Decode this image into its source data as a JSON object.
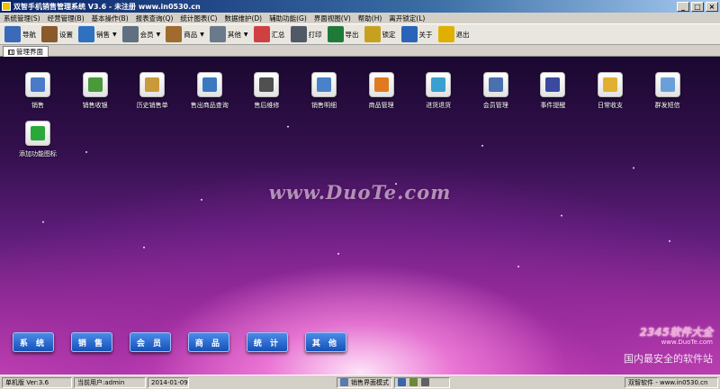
{
  "window": {
    "title": "双智手机销售管理系统 V3.6  - 未注册 www.in0530.cn"
  },
  "menu": [
    "系统管理(S)",
    "经营管理(B)",
    "基本操作(B)",
    "报表查询(Q)",
    "统计图表(C)",
    "数据维护(D)",
    "辅助功能(G)",
    "界面视图(V)",
    "帮助(H)",
    "离开锁定(L)"
  ],
  "toolbar": [
    {
      "label": "导航",
      "icon": "monitor-icon",
      "color": "#3a6ab8",
      "dropdown": false
    },
    {
      "label": "设置",
      "icon": "settings-book-icon",
      "color": "#8a5a2a",
      "dropdown": false
    },
    {
      "label": "销售",
      "icon": "shop-icon",
      "color": "#3070c0",
      "dropdown": true
    },
    {
      "label": "会员",
      "icon": "member-card-icon",
      "color": "#607080",
      "dropdown": true
    },
    {
      "label": "商品",
      "icon": "goods-box-icon",
      "color": "#a06a30",
      "dropdown": true
    },
    {
      "label": "其他",
      "icon": "grid-table-icon",
      "color": "#6a7a8a",
      "dropdown": true
    },
    {
      "label": "汇总",
      "icon": "pie-chart-icon",
      "color": "#d04040",
      "dropdown": false
    },
    {
      "label": "打印",
      "icon": "printer-icon",
      "color": "#505a66",
      "dropdown": false
    },
    {
      "label": "导出",
      "icon": "excel-icon",
      "color": "#1f7a3a",
      "dropdown": false
    },
    {
      "label": "锁定",
      "icon": "lock-icon",
      "color": "#c8a020",
      "dropdown": false
    },
    {
      "label": "关于",
      "icon": "about-monitor-icon",
      "color": "#2a64b8",
      "dropdown": false
    },
    {
      "label": "退出",
      "icon": "exit-runner-icon",
      "color": "#e0b000",
      "dropdown": false
    }
  ],
  "tab": {
    "label": "管理界面"
  },
  "desktop_icons": [
    {
      "label": "销售",
      "icon": "sales-icon",
      "color": "#4a7ac8"
    },
    {
      "label": "销售收银",
      "icon": "cashier-yen-icon",
      "color": "#4a9a3a"
    },
    {
      "label": "历史销售单",
      "icon": "history-order-icon",
      "color": "#c89a3a"
    },
    {
      "label": "售出商品查询",
      "icon": "sold-query-icon",
      "color": "#3a78c0"
    },
    {
      "label": "售后维修",
      "icon": "repair-tools-icon",
      "color": "#505050"
    },
    {
      "label": "销售明细",
      "icon": "sales-detail-icon",
      "color": "#4a82c8"
    },
    {
      "label": "商品管理",
      "icon": "goods-manage-icon",
      "color": "#e07a20"
    },
    {
      "label": "进货退货",
      "icon": "purchase-return-icon",
      "color": "#3aa0d0"
    },
    {
      "label": "会员管理",
      "icon": "member-manage-icon",
      "color": "#4a70b0"
    },
    {
      "label": "事件提醒",
      "icon": "clock-reminder-icon",
      "color": "#3a4aa0"
    },
    {
      "label": "日常收支",
      "icon": "coins-icon",
      "color": "#e0b030"
    },
    {
      "label": "群发短信",
      "icon": "sms-bubble-icon",
      "color": "#6aa0d8"
    },
    {
      "label": "添加功能图标",
      "icon": "add-plus-icon",
      "color": "#2aa83a"
    }
  ],
  "watermark": "www.DuoTe.com",
  "nav_buttons": [
    "系 统",
    "销 售",
    "会 员",
    "商 品",
    "统 计",
    "其 他"
  ],
  "brand": {
    "logo": "2345软件大全",
    "url": "www.DuoTe.com",
    "slogan": "国内最安全的软件站"
  },
  "status": {
    "version": "单机版 Ver:3.6",
    "user": "当前用户:admin",
    "date": "2014-01-09",
    "mode": "销售界面模式",
    "company": "双智软件 - www.in0530.cn"
  }
}
